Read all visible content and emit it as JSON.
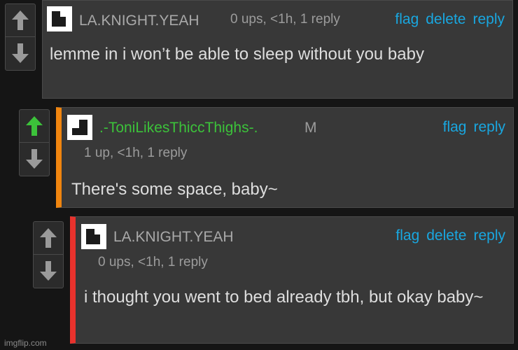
{
  "comments": [
    {
      "username": "LA.KNIGHT.YEAH",
      "meta": "0 ups, <1h, 1 reply",
      "actions": {
        "flag": "flag",
        "delete": "delete",
        "reply": "reply"
      },
      "text": "lemme in i won’t be able to sleep without you baby",
      "upvoted": false
    },
    {
      "username": ".-ToniLikesThiccThighs-.",
      "badge": "M",
      "meta": "1 up, <1h, 1 reply",
      "actions": {
        "flag": "flag",
        "reply": "reply"
      },
      "text": "There's some space, baby~",
      "upvoted": true
    },
    {
      "username": "LA.KNIGHT.YEAH",
      "meta": "0 ups, <1h, 1 reply",
      "actions": {
        "flag": "flag",
        "delete": "delete",
        "reply": "reply"
      },
      "text": "i thought you went to bed already tbh, but okay baby~",
      "upvoted": false
    }
  ],
  "watermark": "imgflip.com",
  "colors": {
    "accent_link": "#19a7e0",
    "upvote_active": "#3cc23a",
    "thread_bar_orange": "#f0850f",
    "thread_bar_red": "#e8322d"
  }
}
